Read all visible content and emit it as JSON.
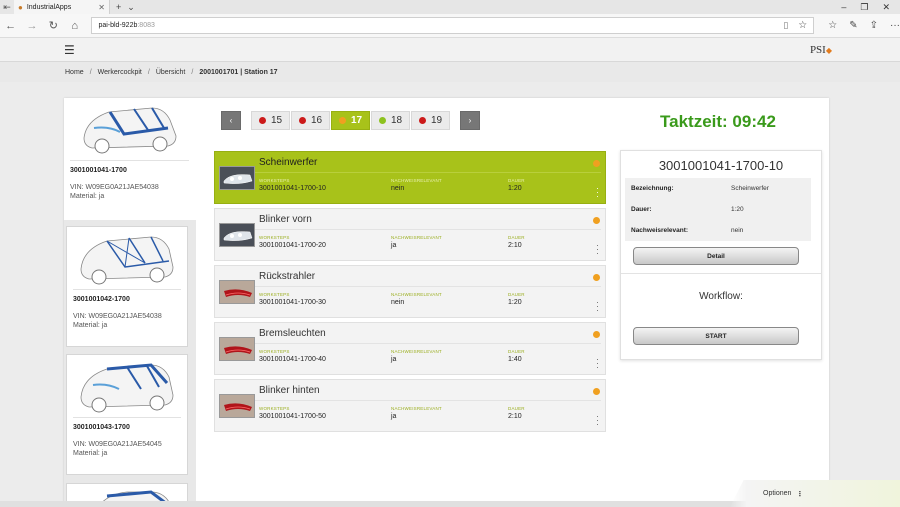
{
  "browser": {
    "tab_title": "IndustrialApps",
    "url_host": "pai-bld-922b",
    "url_port": ":8083"
  },
  "app": {
    "logo": "PSI"
  },
  "breadcrumb": {
    "items": [
      "Home",
      "Werkercockpit",
      "Übersicht"
    ],
    "current": "2001001701 | Station 17"
  },
  "vehicles": [
    {
      "id": "3001001041-1700",
      "vin": "VIN: W09EG0A21JAE54038",
      "material": "Material: ja",
      "active": true
    },
    {
      "id": "3001001042-1700",
      "vin": "VIN: W09EG0A21JAE54038",
      "material": "Material: ja",
      "active": false
    },
    {
      "id": "3001001043-1700",
      "vin": "VIN: W09EG0A21JAE54045",
      "material": "Material: ja",
      "active": false
    }
  ],
  "stations": [
    {
      "label": "15",
      "dot": "#cc1a1a"
    },
    {
      "label": "16",
      "dot": "#cc1a1a"
    },
    {
      "label": "17",
      "dot": "#f0a020",
      "selected": true
    },
    {
      "label": "18",
      "dot": "#8dc21f"
    },
    {
      "label": "19",
      "dot": "#cc1a1a"
    }
  ],
  "taktzeit": "Taktzeit: 09:42",
  "column_labels": {
    "worksteps": "WORKSTEPS",
    "nachweis": "NACHWEISRELEVANT",
    "dauer": "DAUER"
  },
  "steps": [
    {
      "name": "Scheinwerfer",
      "id": "3001001041-1700-10",
      "nachweis": "nein",
      "dauer": "1:20",
      "active": true,
      "thumb": "headlight"
    },
    {
      "name": "Blinker vorn",
      "id": "3001001041-1700-20",
      "nachweis": "ja",
      "dauer": "2:10",
      "active": false,
      "thumb": "headlight"
    },
    {
      "name": "Rückstrahler",
      "id": "3001001041-1700-30",
      "nachweis": "nein",
      "dauer": "1:20",
      "active": false,
      "thumb": "taillight"
    },
    {
      "name": "Bremsleuchten",
      "id": "3001001041-1700-40",
      "nachweis": "ja",
      "dauer": "1:40",
      "active": false,
      "thumb": "taillight"
    },
    {
      "name": "Blinker hinten",
      "id": "3001001041-1700-50",
      "nachweis": "ja",
      "dauer": "2:10",
      "active": false,
      "thumb": "taillight"
    }
  ],
  "detail": {
    "title": "3001001041-1700-10",
    "rows": [
      {
        "key": "Bezeichnung:",
        "value": "Scheinwerfer"
      },
      {
        "key": "Dauer:",
        "value": "1:20"
      },
      {
        "key": "Nachweisrelevant:",
        "value": "nein"
      }
    ],
    "detail_button": "Detail",
    "workflow_label": "Workflow:",
    "start_button": "START"
  },
  "footer": {
    "options_label": "Optionen"
  },
  "colors": {
    "accent_green": "#a8c21a",
    "takt_green": "#3a9a1b",
    "status_orange": "#f0a020",
    "status_red": "#cc1a1a"
  }
}
